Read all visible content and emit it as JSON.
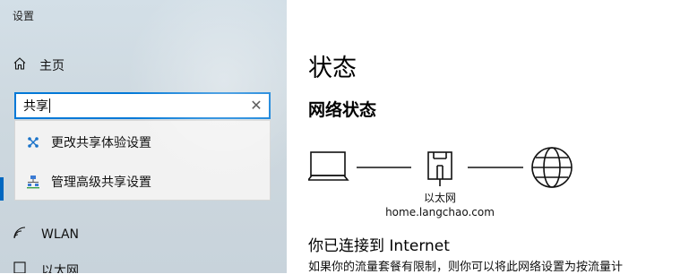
{
  "app": {
    "title": "设置"
  },
  "nav": {
    "home": {
      "label": "主页",
      "icon": "home-icon"
    },
    "wlan": {
      "label": "WLAN",
      "icon": "wifi-icon"
    },
    "partial": {
      "label": "以太网",
      "icon": "ethernet-icon"
    }
  },
  "search": {
    "value": "共享",
    "clear_icon": "close-icon"
  },
  "suggestions": [
    {
      "label": "更改共享体验设置",
      "icon": "share-experience-icon"
    },
    {
      "label": "管理高级共享设置",
      "icon": "network-sharing-icon"
    }
  ],
  "main": {
    "title": "状态",
    "section": "网络状态",
    "network": {
      "type_label": "以太网",
      "name": "home.langchao.com"
    },
    "connected_text": "你已连接到 Internet",
    "description": "如果你的流量套餐有限制，则你可以将此网络设置为按流量计"
  },
  "colors": {
    "accent": "#0078d7",
    "sidebar": "#cdd8df"
  }
}
